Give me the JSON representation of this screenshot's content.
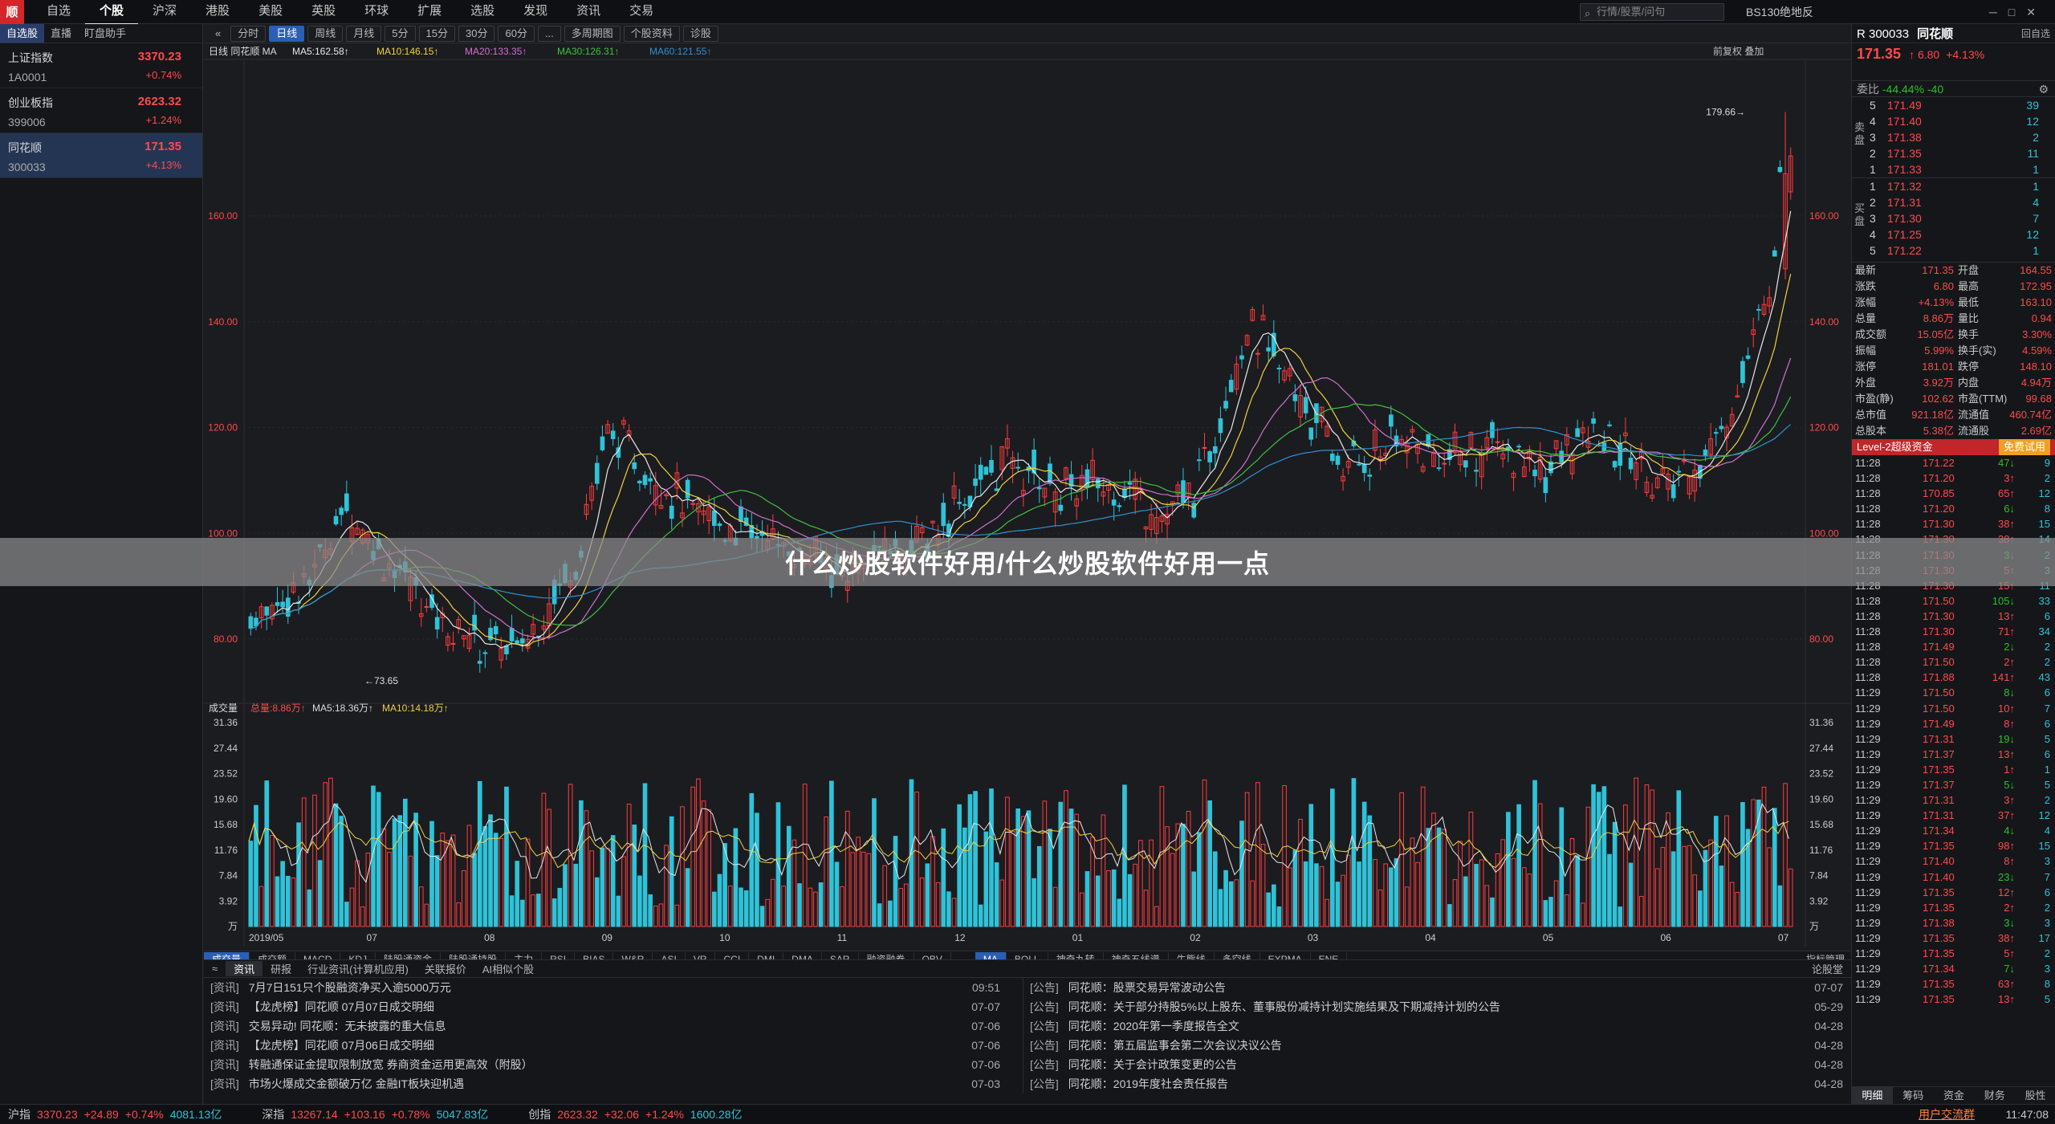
{
  "menu": {
    "items": [
      "自选",
      "个股",
      "沪深",
      "港股",
      "美股",
      "英股",
      "环球",
      "扩展",
      "选股",
      "发现",
      "资讯",
      "交易"
    ],
    "active": 1
  },
  "search": {
    "placeholder": "行情/股票/问句"
  },
  "broker": "BS130绝地反",
  "sidebar": {
    "tabs": [
      "自选股",
      "直播",
      "盯盘助手"
    ],
    "items": [
      {
        "name": "上证指数",
        "code": "1A0001",
        "price": "3370.23",
        "chg": "+0.74%"
      },
      {
        "name": "创业板指",
        "code": "399006",
        "price": "2623.32",
        "chg": "+1.24%"
      },
      {
        "name": "同花顺",
        "code": "300033",
        "price": "171.35",
        "chg": "+4.13%"
      }
    ]
  },
  "periods": [
    "分时",
    "日线",
    "周线",
    "月线",
    "5分",
    "15分",
    "30分",
    "60分",
    "...",
    "多周期图",
    "个股资料",
    "诊股"
  ],
  "ma_legend": {
    "label": "日线 同花顺 MA",
    "ma5": "MA5:162.58↑",
    "ma10": "MA10:146.15↑",
    "ma20": "MA20:133.35↑",
    "ma30": "MA30:126.31↑",
    "ma60": "MA60:121.55↑"
  },
  "vol_legend": {
    "label": "成交量",
    "total": "总量:8.86万↑",
    "ma5": "MA5:18.36万↑",
    "ma10": "MA10:14.18万↑"
  },
  "toolbar_right": "前复权 叠加",
  "chart_data": {
    "type": "candlestick",
    "price_axis": [
      "160.00",
      "140.00",
      "120.00",
      "100.00",
      "80.00"
    ],
    "vol_axis": [
      "31.36",
      "27.44",
      "23.52",
      "19.60",
      "15.68",
      "11.76",
      "7.84",
      "3.92",
      "万"
    ],
    "x_labels": [
      "2019/05",
      "07",
      "08",
      "09",
      "10",
      "11",
      "12",
      "01",
      "02",
      "03",
      "04",
      "05",
      "06",
      "07"
    ],
    "annotations": {
      "high": "179.66",
      "low": "73.65"
    },
    "colors": {
      "up": "#ff3c3c",
      "down": "#2ec3d8",
      "ma5": "#e8e8e8",
      "ma10": "#f0d040",
      "ma20": "#d070d0",
      "ma30": "#40c040",
      "ma60": "#3090d0"
    }
  },
  "indicator_tabs": [
    "成交量",
    "成交额",
    "MACD",
    "KDJ",
    "陆股通资金",
    "陆股通持股",
    "主力",
    "RSI",
    "BIAS",
    "W&R",
    "ASI",
    "VR",
    "CCI",
    "DMI",
    "DMA",
    "SAR",
    "融资融券",
    "OBV"
  ],
  "overlay_tabs": [
    "MA",
    "BOLL",
    "神奇九转",
    "神奇五线谱",
    "牛熊线",
    "多空线",
    "EXPMA",
    "ENE"
  ],
  "indicator_manage": "指标管理",
  "news": {
    "tabs": [
      "资讯",
      "研报",
      "行业资讯(计算机应用)",
      "关联报价",
      "AI相似个股"
    ],
    "corner": "论股堂",
    "left": [
      [
        "[资讯]",
        "7月7日151只个股融资净买入逾5000万元",
        "09:51"
      ],
      [
        "[资讯]",
        "【龙虎榜】同花顺 07月07日成交明细",
        "07-07"
      ],
      [
        "[资讯]",
        "交易异动! 同花顺：无未披露的重大信息",
        "07-06"
      ],
      [
        "[资讯]",
        "【龙虎榜】同花顺 07月06日成交明细",
        "07-06"
      ],
      [
        "[资讯]",
        "转融通保证金提取限制放宽 券商资金运用更高效（附股）",
        "07-06"
      ],
      [
        "[资讯]",
        "市场火爆成交金额破万亿 金融IT板块迎机遇",
        "07-03"
      ]
    ],
    "right": [
      [
        "[公告]",
        "同花顺：股票交易异常波动公告",
        "07-07"
      ],
      [
        "[公告]",
        "同花顺：关于部分持股5%以上股东、董事股份减持计划实施结果及下期减持计划的公告",
        "05-29"
      ],
      [
        "[公告]",
        "同花顺：2020年第一季度报告全文",
        "04-28"
      ],
      [
        "[公告]",
        "同花顺：第五届监事会第二次会议决议公告",
        "04-28"
      ],
      [
        "[公告]",
        "同花顺：关于会计政策变更的公告",
        "04-28"
      ],
      [
        "[公告]",
        "同花顺：2019年度社会责任报告",
        "04-28"
      ]
    ]
  },
  "quote": {
    "code": "300033",
    "name": "同花顺",
    "price": "171.35",
    "chg": "6.80",
    "pct": "+4.13%",
    "weibi": "-44.44%",
    "weicha": "-40",
    "sell": [
      [
        "5",
        "171.49",
        "39"
      ],
      [
        "4",
        "171.40",
        "12"
      ],
      [
        "3",
        "171.38",
        "2"
      ],
      [
        "2",
        "171.35",
        "11"
      ],
      [
        "1",
        "171.33",
        "1"
      ]
    ],
    "buy": [
      [
        "1",
        "171.32",
        "1"
      ],
      [
        "2",
        "171.31",
        "4"
      ],
      [
        "3",
        "171.30",
        "7"
      ],
      [
        "4",
        "171.25",
        "12"
      ],
      [
        "5",
        "171.22",
        "1"
      ]
    ],
    "stats": [
      [
        "最新",
        "171.35",
        "开盘",
        "164.55"
      ],
      [
        "涨跌",
        "6.80",
        "最高",
        "172.95"
      ],
      [
        "涨幅",
        "+4.13%",
        "最低",
        "163.10"
      ],
      [
        "总量",
        "8.86万",
        "量比",
        "0.94"
      ],
      [
        "成交额",
        "15.05亿",
        "换手",
        "3.30%"
      ],
      [
        "振幅",
        "5.99%",
        "换手(实)",
        "4.59%"
      ],
      [
        "涨停",
        "181.01",
        "跌停",
        "148.10"
      ],
      [
        "外盘",
        "3.92万",
        "内盘",
        "4.94万"
      ],
      [
        "市盈(静)",
        "102.62",
        "市盈(TTM)",
        "99.68"
      ],
      [
        "总市值",
        "921.18亿",
        "流通值",
        "460.74亿"
      ],
      [
        "总股本",
        "5.38亿",
        "流通股",
        "2.69亿"
      ]
    ],
    "l2": "Level-2超级资金",
    "l2free": "免费试用",
    "ticks": [
      [
        "11:28",
        "171.22",
        "47",
        "9"
      ],
      [
        "11:28",
        "171.20",
        "3",
        "2"
      ],
      [
        "11:28",
        "170.85",
        "65",
        "12"
      ],
      [
        "11:28",
        "171.20",
        "6",
        "8"
      ],
      [
        "11:28",
        "171.30",
        "38",
        "15"
      ],
      [
        "11:28",
        "171.30",
        "38",
        "14"
      ],
      [
        "11:28",
        "171.30",
        "3",
        "2"
      ],
      [
        "11:28",
        "171.30",
        "5",
        "3"
      ],
      [
        "11:28",
        "171.30",
        "15",
        "11"
      ],
      [
        "11:28",
        "171.50",
        "105",
        "33"
      ],
      [
        "11:28",
        "171.30",
        "13",
        "6"
      ],
      [
        "11:28",
        "171.30",
        "71",
        "34"
      ],
      [
        "11:28",
        "171.49",
        "2",
        "2"
      ],
      [
        "11:28",
        "171.50",
        "2",
        "2"
      ],
      [
        "11:28",
        "171.88",
        "141",
        "43"
      ],
      [
        "11:29",
        "171.50",
        "8",
        "6"
      ],
      [
        "11:29",
        "171.50",
        "10",
        "7"
      ],
      [
        "11:29",
        "171.49",
        "8",
        "6"
      ],
      [
        "11:29",
        "171.31",
        "19",
        "5"
      ],
      [
        "11:29",
        "171.37",
        "13",
        "6"
      ],
      [
        "11:29",
        "171.35",
        "1",
        "1"
      ],
      [
        "11:29",
        "171.37",
        "5",
        "5"
      ],
      [
        "11:29",
        "171.31",
        "3",
        "2"
      ],
      [
        "11:29",
        "171.31",
        "37",
        "12"
      ],
      [
        "11:29",
        "171.34",
        "4",
        "4"
      ],
      [
        "11:29",
        "171.35",
        "98",
        "15"
      ],
      [
        "11:29",
        "171.40",
        "8",
        "3"
      ],
      [
        "11:29",
        "171.40",
        "23",
        "7"
      ],
      [
        "11:29",
        "171.35",
        "12",
        "6"
      ],
      [
        "11:29",
        "171.35",
        "2",
        "2"
      ],
      [
        "11:29",
        "171.38",
        "3",
        "3"
      ],
      [
        "11:29",
        "171.35",
        "38",
        "17"
      ],
      [
        "11:29",
        "171.35",
        "5",
        "2"
      ],
      [
        "11:29",
        "171.34",
        "7",
        "3"
      ],
      [
        "11:29",
        "171.35",
        "63",
        "8"
      ],
      [
        "11:29",
        "171.35",
        "13",
        "5"
      ]
    ],
    "bottom_tabs": [
      "明细",
      "筹码",
      "资金",
      "财务",
      "股性"
    ]
  },
  "status": {
    "sh": "沪指",
    "sh_v": "3370.23",
    "sh_c": "+24.89",
    "sh_p": "+0.74%",
    "sh_a": "4081.13亿",
    "sz": "深指",
    "sz_v": "13267.14",
    "sz_c": "+103.16",
    "sz_p": "+0.78%",
    "sz_a": "5047.83亿",
    "cy": "创指",
    "cy_v": "2623.32",
    "cy_c": "+32.06",
    "cy_p": "+1.24%",
    "cy_a": "1600.28亿",
    "right": "用户交流群",
    "time": "11:47:08"
  },
  "banner": "什么炒股软件好用/什么炒股软件好用一点"
}
